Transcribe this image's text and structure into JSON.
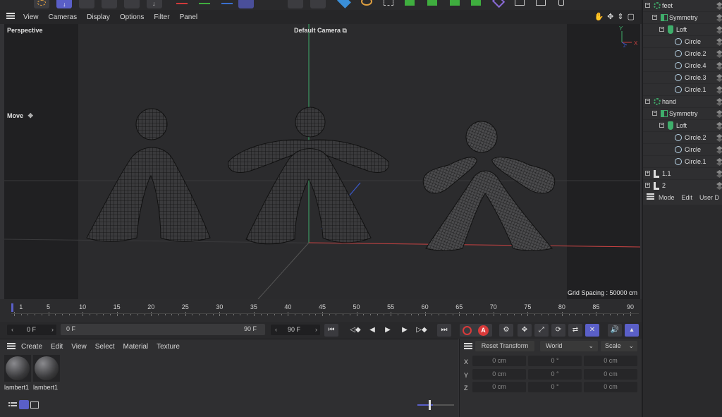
{
  "viewport": {
    "menu": [
      "View",
      "Cameras",
      "Display",
      "Options",
      "Filter",
      "Panel"
    ],
    "label_projection": "Perspective",
    "label_camera": "Default Camera",
    "label_tool": "Move",
    "grid_spacing": "Grid Spacing : 50000 cm",
    "axis_y": "Y",
    "axis_x": "X",
    "axis_z": "Z"
  },
  "timeline": {
    "ticks": [
      "1",
      "5",
      "10",
      "15",
      "20",
      "25",
      "30",
      "35",
      "40",
      "45",
      "50",
      "55",
      "60",
      "65",
      "70",
      "75",
      "80",
      "85",
      "90"
    ]
  },
  "playbar": {
    "current_frame": "0 F",
    "range_start": "0 F",
    "range_end": "90 F",
    "end_frame": "90 F"
  },
  "materials": {
    "menu": [
      "Create",
      "Edit",
      "View",
      "Select",
      "Material",
      "Texture"
    ],
    "items": [
      {
        "name": "lambert1"
      },
      {
        "name": "lambert1"
      }
    ]
  },
  "attributes": {
    "reset_transform": "Reset Transform",
    "space": "World",
    "mode": "Scale",
    "rows": [
      {
        "axis": "X",
        "pos": "0 cm",
        "rot": "0 °",
        "scale": "0 cm"
      },
      {
        "axis": "Y",
        "pos": "0 cm",
        "rot": "0 °",
        "scale": "0 cm"
      },
      {
        "axis": "Z",
        "pos": "0 cm",
        "rot": "0 °",
        "scale": "0 cm"
      }
    ]
  },
  "objects": {
    "rows": [
      {
        "label": "feet"
      },
      {
        "label": "Symmetry"
      },
      {
        "label": "Loft"
      },
      {
        "label": "Circle"
      },
      {
        "label": "Circle.2"
      },
      {
        "label": "Circle.4"
      },
      {
        "label": "Circle.3"
      },
      {
        "label": "Circle.1"
      },
      {
        "label": "hand"
      },
      {
        "label": "Symmetry"
      },
      {
        "label": "Loft"
      },
      {
        "label": "Circle.2"
      },
      {
        "label": "Circle"
      },
      {
        "label": "Circle.1"
      },
      {
        "label": "1.1"
      },
      {
        "label": "2"
      }
    ],
    "bottom_menu": [
      "Mode",
      "Edit",
      "User D"
    ]
  },
  "colors": {
    "accent_blue": "#5a5fc8",
    "record_red": "#d93a3a",
    "axis_green": "#3fae6b",
    "axis_red": "#c84040"
  }
}
